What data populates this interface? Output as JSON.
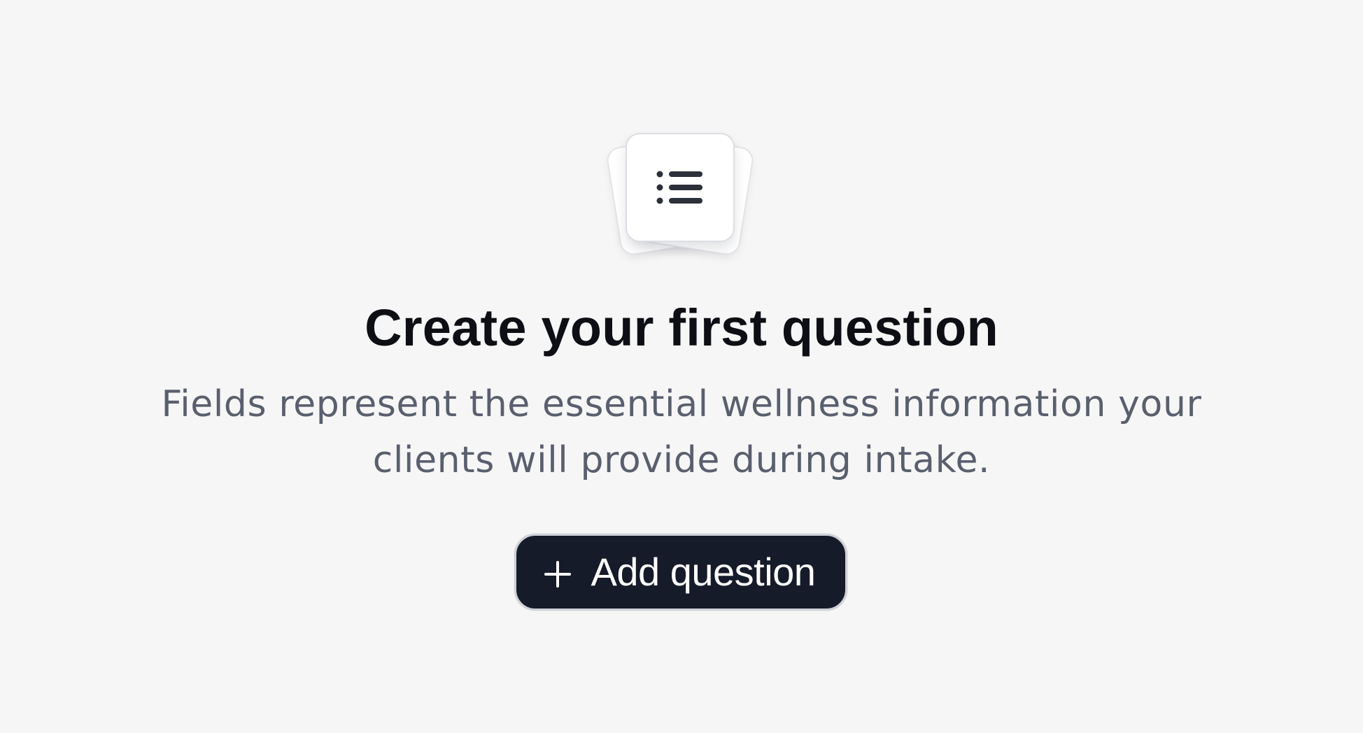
{
  "empty_state": {
    "illustration_icon": "list-icon",
    "title": "Create your first question",
    "description": "Fields represent the essential wellness information your clients will provide during intake.",
    "add_button": {
      "label": "Add question",
      "icon": "plus-icon"
    }
  },
  "colors": {
    "background": "#f6f6f6",
    "title": "#0d0f14",
    "description": "#5a5f6e",
    "button_background": "#151b29",
    "button_text": "#ffffff",
    "icon": "#2b303b"
  }
}
